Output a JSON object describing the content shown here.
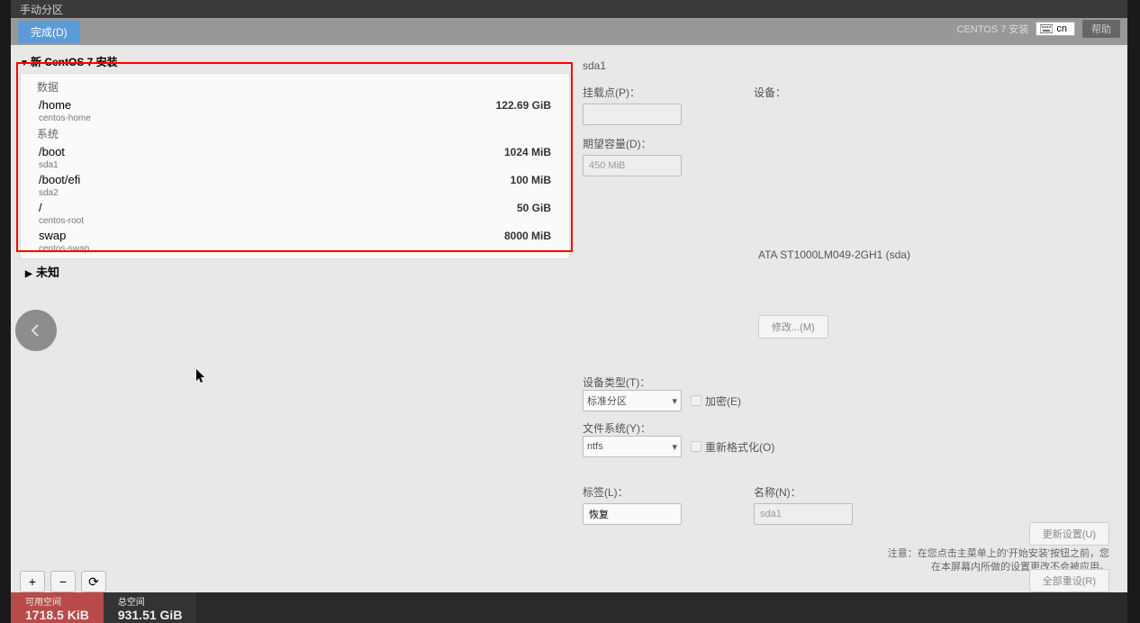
{
  "topbar_title": "手动分区",
  "done_btn": "完成(D)",
  "header_title": "CENTOS 7 安装",
  "lang_label": "cn",
  "help_btn": "帮助",
  "tree": {
    "install_header": "新 CentOS 7 安装",
    "data_section": "数据",
    "system_section": "系统",
    "unknown": "未知"
  },
  "partitions": {
    "data": [
      {
        "name": "/home",
        "dev": "centos-home",
        "size": "122.69 GiB"
      }
    ],
    "system": [
      {
        "name": "/boot",
        "dev": "sda1",
        "size": "1024 MiB"
      },
      {
        "name": "/boot/efi",
        "dev": "sda2",
        "size": "100 MiB"
      },
      {
        "name": "/",
        "dev": "centos-root",
        "size": "50 GiB"
      },
      {
        "name": "swap",
        "dev": "centos-swap",
        "size": "8000 MiB"
      }
    ]
  },
  "rightpanel": {
    "selected_dev": "sda1",
    "mountpoint_label": "挂载点(P)：",
    "device_section_label": "设备：",
    "capacity_label": "期望容量(D)：",
    "capacity_value": "450 MiB",
    "disk_info": "ATA ST1000LM049-2GH1 (sda)",
    "modify_btn": "修改...(M)",
    "device_type_label": "设备类型(T)：",
    "device_type_value": "标准分区",
    "encrypt_label": "加密(E)",
    "filesystem_label": "文件系统(Y)：",
    "filesystem_value": "ntfs",
    "reformat_label": "重新格式化(O)",
    "label_label": "标签(L)：",
    "label_value": "恢复",
    "name_label": "名称(N)：",
    "name_value": "sda1",
    "update_btn": "更新设置(U)",
    "note_line1": "注意：在您点击主菜单上的'开始安装'按钮之前，您",
    "note_line2": "在本屏幕内所做的设置更改不会被应用。",
    "all_reset_btn": "全部重设(R)"
  },
  "footer": {
    "avail_label": "可用空间",
    "avail_value": "1718.5 KiB",
    "total_label": "总空间",
    "total_value": "931.51 GiB"
  },
  "toolbar": {
    "plus": "+",
    "minus": "−",
    "refresh": "⟳"
  }
}
